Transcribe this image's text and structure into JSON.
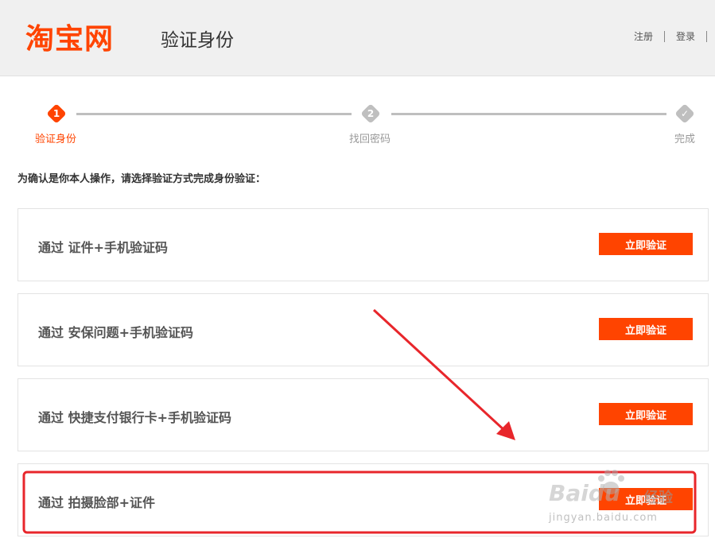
{
  "header": {
    "logo": "淘宝网",
    "title": "验证身份",
    "links": [
      "注册",
      "登录"
    ]
  },
  "steps": [
    {
      "number": "1",
      "label": "验证身份",
      "state": "active"
    },
    {
      "number": "2",
      "label": "找回密码",
      "state": "pending"
    },
    {
      "number": "✓",
      "label": "完成",
      "state": "pending"
    }
  ],
  "intro": "为确认是你本人操作，请选择验证方式完成身份验证：",
  "options": [
    {
      "label": "通过 证件+手机验证码",
      "button": "立即验证"
    },
    {
      "label": "通过 安保问题+手机验证码",
      "button": "立即验证"
    },
    {
      "label": "通过 快捷支付银行卡+手机验证码",
      "button": "立即验证"
    },
    {
      "label": "通过 拍摄脸部+证件",
      "button": "立即验证"
    }
  ],
  "watermark": {
    "brand": "Baidu",
    "cn": "经验",
    "url": "jingyan.baidu.com"
  },
  "colors": {
    "accent": "#ff4400",
    "annotation": "#e8262b",
    "step_inactive": "#bfbfbf"
  }
}
